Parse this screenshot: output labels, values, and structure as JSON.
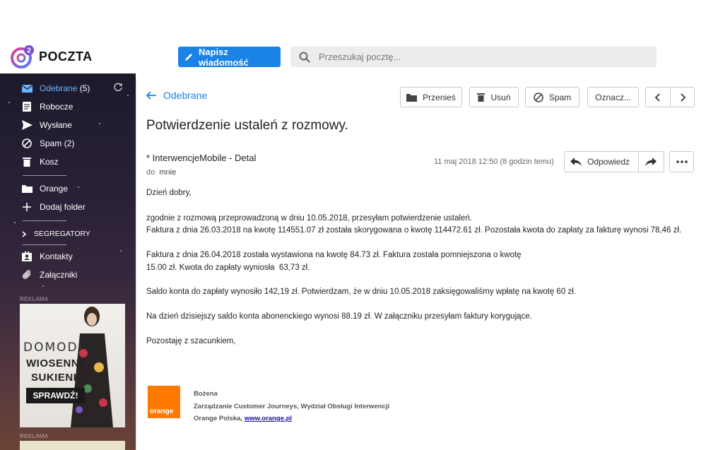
{
  "app": {
    "name": "POCZTA",
    "logo_badge": "2"
  },
  "toolbar": {
    "compose_label": "Napisz wiadomość",
    "search_placeholder": "Przeszukaj pocztę..."
  },
  "sidebar": {
    "items": [
      {
        "label": "Odebrane",
        "count": "(5)",
        "icon": "mail-icon"
      },
      {
        "label": "Robocze",
        "count": "",
        "icon": "draft-icon"
      },
      {
        "label": "Wysłane",
        "count": "",
        "icon": "send-icon"
      },
      {
        "label": "Spam",
        "count": "(2)",
        "icon": "spam-icon"
      },
      {
        "label": "Kosz",
        "count": "",
        "icon": "trash-icon"
      },
      {
        "label": "Orange",
        "count": "",
        "icon": "folder-icon"
      },
      {
        "label": "Dodaj folder",
        "count": "",
        "icon": "plus-icon"
      },
      {
        "label": "SEGREGATORY",
        "count": "",
        "icon": "chevron-right-icon"
      },
      {
        "label": "Kontakty",
        "count": "",
        "icon": "contacts-icon"
      },
      {
        "label": "Załączniki",
        "count": "",
        "icon": "paperclip-icon"
      }
    ],
    "ad_label": "REKLAMA",
    "ad_label_2": "REKLAMA",
    "ad": {
      "brand": "DOMODI",
      "line1": "WIOSENNE",
      "line2": "SUKIENKI",
      "cta": "SPRAWDŹ!"
    }
  },
  "message_toolbar": {
    "back_label": "Odebrane",
    "move_label": "Przenieś",
    "delete_label": "Usuń",
    "spam_label": "Spam",
    "mark_label": "Oznacz..."
  },
  "message": {
    "subject": "Potwierdzenie ustaleń z rozmowy.",
    "from": "* InterwencjeMobile - Detal",
    "to_prefix": "do",
    "to": "mnie",
    "date": "11 maj 2018 12:50 (8 godzin temu)",
    "reply_label": "Odpowiedz",
    "body": {
      "greeting": "Dzień dobry,",
      "p1_line1": "zgodnie z rozmową przeprowadzoną w dniu 10.05.2018, przesyłam potwierdzenie ustaleń.",
      "p1_line2": "Faktura z dnia 26.03.2018 na kwotę 114551.07 zł została skorygowana o kwotę 114472.61 zł. Pozostała kwota do zapłaty za fakturę wynosi 78,46 zł.",
      "p2_line1": "Faktura z dnia 26.04.2018 została wystawiona na kwotę 84.73 zł. Faktura została pomniejszona o kwotę",
      "p2_line2": "15.00 zł. Kwota do zapłaty wyniosła  63,73 zł.",
      "p3": "Saldo konta do zapłaty wynosiło 142,19 zł. Potwierdzam, że w dniu 10.05.2018 zaksięgowaliśmy wpłatę na kwotę 60 zł.",
      "p4": "Na dzień dzisiejszy saldo konta abonenckiego wynosi 88.19 zł. W załączniku przesyłam faktury korygujące.",
      "closing": "Pozostaję z szacunkiem,"
    },
    "signature": {
      "logo_text": "orange",
      "name": "Bożena",
      "dept": "Zarządzanie Customer Journeys, Wydział Obsługi Interwencji",
      "org_prefix": "Orange Polska, ",
      "link": "www.orange.pl"
    }
  },
  "colors": {
    "accent": "#1b82e6",
    "orange": "#ff7900",
    "active_nav": "#6db3ff"
  }
}
